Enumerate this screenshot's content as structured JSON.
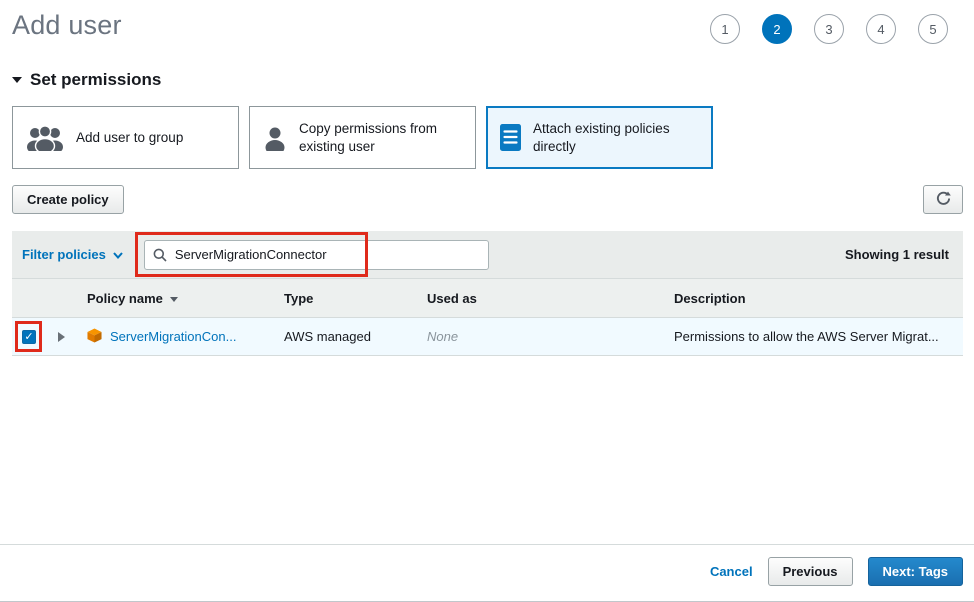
{
  "colors": {
    "accent_blue": "#0073bb",
    "annotation_red": "#df2a1b",
    "selected_row_bg": "#f1faff",
    "selected_card_bg": "#ecf6fd"
  },
  "header": {
    "title": "Add user"
  },
  "steps": {
    "labels": [
      "1",
      "2",
      "3",
      "4",
      "5"
    ],
    "active": "2"
  },
  "permissions": {
    "section_title": "Set permissions",
    "cards": [
      {
        "label": "Add user to group",
        "icon": "group-icon",
        "selected": false
      },
      {
        "label": "Copy permissions from existing user",
        "icon": "user-icon",
        "selected": false
      },
      {
        "label": "Attach existing policies directly",
        "icon": "document-icon",
        "selected": true
      }
    ]
  },
  "toolbar": {
    "create_policy": "Create policy",
    "refresh_icon": "refresh-icon"
  },
  "filter": {
    "label": "Filter policies",
    "search_value": "ServerMigrationConnector",
    "results": "Showing 1 result"
  },
  "table": {
    "headers": {
      "policy_name": "Policy name",
      "type": "Type",
      "used_as": "Used as",
      "description": "Description"
    },
    "rows": [
      {
        "checked": true,
        "policy_name": "ServerMigrationCon...",
        "type": "AWS managed",
        "used_as": "None",
        "description": "Permissions to allow the AWS Server Migrat...",
        "icon": "policy-icon"
      }
    ]
  },
  "footer": {
    "cancel": "Cancel",
    "previous": "Previous",
    "next": "Next: Tags"
  }
}
